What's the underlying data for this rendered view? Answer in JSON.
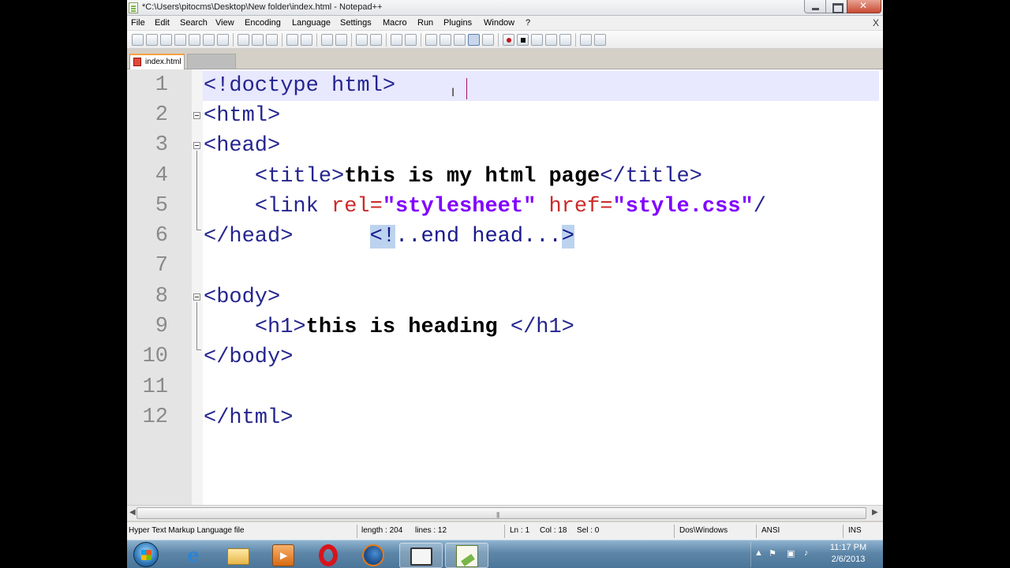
{
  "window": {
    "title": "*C:\\Users\\pitocms\\Desktop\\New folder\\index.html - Notepad++"
  },
  "menu": {
    "items": [
      "File",
      "Edit",
      "Search",
      "View",
      "Encoding",
      "Language",
      "Settings",
      "Macro",
      "Run",
      "Plugins",
      "Window",
      "?"
    ],
    "close_doc": "X"
  },
  "tabs": [
    {
      "label": "index.html",
      "active": true
    }
  ],
  "editor": {
    "line_numbers": [
      "1",
      "2",
      "3",
      "4",
      "5",
      "6",
      "7",
      "8",
      "9",
      "10",
      "11",
      "12"
    ],
    "current_line": 1,
    "lines": [
      "<!doctype html>",
      "<html>",
      "<head>",
      "    <title>this is my html page</title>",
      "    <link rel=\"stylesheet\" href=\"style.css\"/",
      "</head>      <!..end head...>",
      "",
      "<body>",
      "    <h1>this is heading </h1>",
      "</body>",
      "",
      "</html>"
    ],
    "tokens": {
      "l1": "<!doctype html>",
      "l2": "<html>",
      "l3": "<head>",
      "l4_open": "<title>",
      "l4_text": "this is my html page",
      "l4_close": "</title>",
      "l5_open": "<link ",
      "l5_rel": "rel=",
      "l5_relval": "\"stylesheet\"",
      "l5_href": " href=",
      "l5_hrefval": "\"style.css\"",
      "l5_end": "/",
      "l6_tag": "</head>",
      "l6_c1": "<!",
      "l6_c2": "..end head...",
      "l6_c3": ">",
      "l8": "<body>",
      "l9_open": "<h1>",
      "l9_text": "this is heading ",
      "l9_close": "</h1>",
      "l10": "</body>",
      "l12": "</html>"
    }
  },
  "status": {
    "file_type": "Hyper Text Markup Language file",
    "length": "length : 204",
    "lines": "lines : 12",
    "ln": "Ln : 1",
    "col": "Col : 18",
    "sel": "Sel : 0",
    "eol": "Dos\\Windows",
    "encoding": "ANSI",
    "mode": "INS"
  },
  "taskbar": {
    "apps": [
      "start-button",
      "internet-explorer",
      "file-explorer",
      "media-player",
      "opera",
      "firefox",
      "blank-window",
      "notepad-plus-plus"
    ],
    "time": "11:17 PM",
    "date": "2/6/2013"
  },
  "colors": {
    "current_line": "#e8e8ff",
    "tag": "#25258f",
    "attribute": "#cc2a2a",
    "attribute_value": "#8000ff",
    "highlight": "#bcd3ef",
    "active_tab_accent": "#f9a13e"
  }
}
